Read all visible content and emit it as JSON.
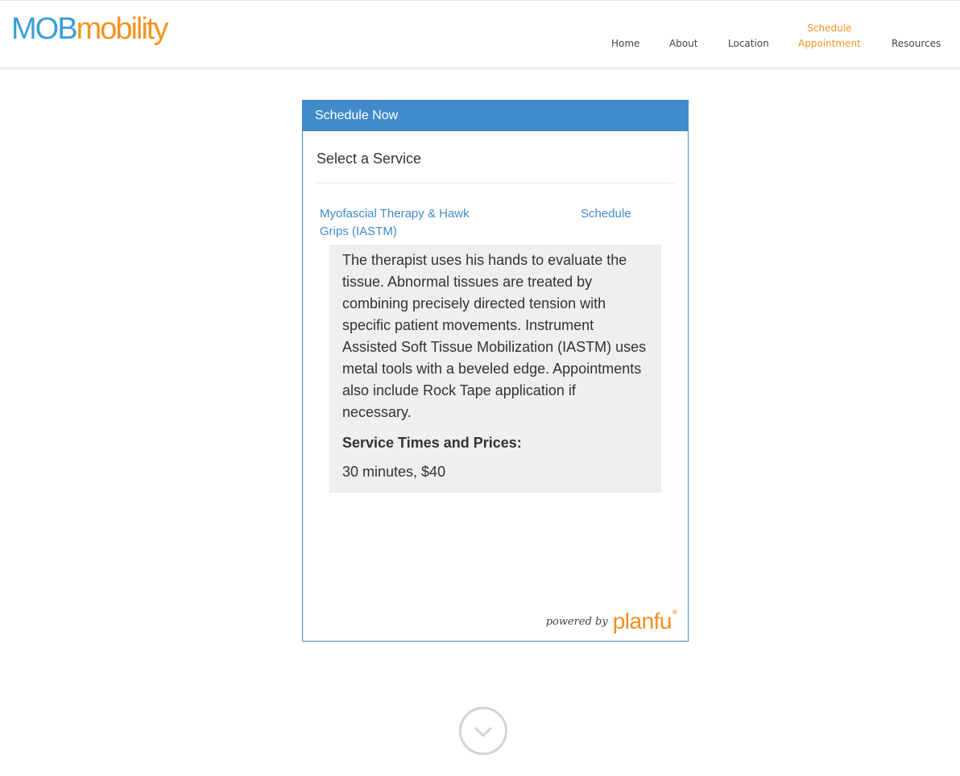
{
  "header": {
    "logo": {
      "part1": "MOB",
      "part2": "mobility"
    },
    "nav": [
      {
        "line1": "Home",
        "line2": ""
      },
      {
        "line1": "About",
        "line2": ""
      },
      {
        "line1": "Location",
        "line2": ""
      },
      {
        "line1": "Schedule",
        "line2": "Appointment"
      },
      {
        "line1": "Resources",
        "line2": ""
      }
    ]
  },
  "widget": {
    "title": "Schedule Now",
    "section_title": "Select a Service",
    "service": {
      "name": "Myofascial Therapy & Hawk Grips (IASTM)",
      "action": "Schedule",
      "description": "The therapist uses his hands to evaluate the tissue. Abnormal tissues are treated by combining precisely directed tension with specific patient movements. Instrument Assisted Soft Tissue Mobilization (IASTM) uses metal tools with a beveled edge. Appointments also include Rock Tape application if necessary.",
      "prices_heading": "Service Times and Prices:",
      "price": "30 minutes, $40"
    },
    "footer": {
      "powered_by": "powered by",
      "brand": "planfu",
      "reg": "®"
    }
  },
  "colors": {
    "accent_blue": "#428bca",
    "brand_orange": "#f29422",
    "logo_blue": "#3a9fd6"
  },
  "icons": {
    "scroll": "chevron-down-circle-icon"
  }
}
